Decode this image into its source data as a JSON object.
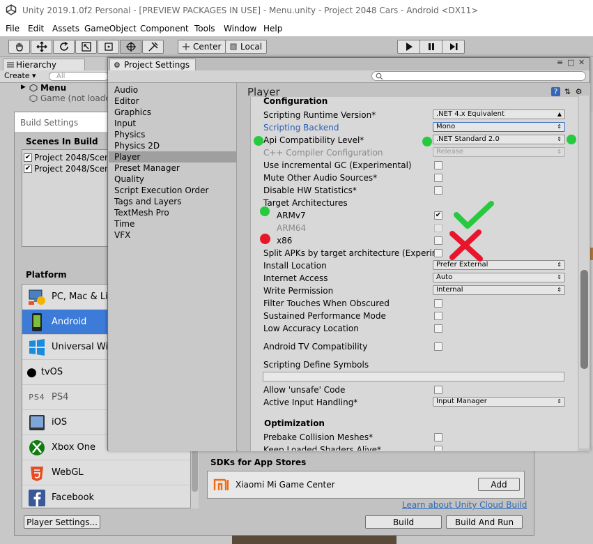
{
  "window": {
    "title": "Unity 2019.1.0f2 Personal - [PREVIEW PACKAGES IN USE] - Menu.unity - Project 2048 Cars - Android <DX11>"
  },
  "menu": [
    "File",
    "Edit",
    "Assets",
    "GameObject",
    "Component",
    "Tools",
    "Window",
    "Help"
  ],
  "toolbar": {
    "center_label": "Center",
    "local_label": "Local"
  },
  "hierarchy": {
    "tab": "Hierarchy",
    "create": "Create",
    "search_placeholder": "All",
    "scene_name": "Menu",
    "item": "Game (not loade"
  },
  "build_settings": {
    "title": "Build Settings",
    "scenes_header": "Scenes In Build",
    "scenes": [
      "Project 2048/Scen",
      "Project 2048/Scen"
    ],
    "platform_header": "Platform",
    "platforms": [
      {
        "name": "PC, Mac & Lin",
        "selected": false
      },
      {
        "name": "Android",
        "selected": true
      },
      {
        "name": "Universal Win",
        "selected": false
      },
      {
        "name": "tvOS",
        "selected": false
      },
      {
        "name": "PS4",
        "selected": false
      },
      {
        "name": "iOS",
        "selected": false
      },
      {
        "name": "Xbox One",
        "selected": false
      },
      {
        "name": "WebGL",
        "selected": false
      },
      {
        "name": "Facebook",
        "selected": false
      }
    ],
    "sdk_header": "SDKs for App Stores",
    "sdk_name": "Xiaomi Mi Game Center",
    "sdk_add": "Add",
    "learn_link": "Learn about Unity Cloud Build",
    "player_settings_btn": "Player Settings...",
    "build_btn": "Build",
    "build_and_run_btn": "Build And Run"
  },
  "project_settings": {
    "tab": "Project Settings",
    "sidebar": [
      "Audio",
      "Editor",
      "Graphics",
      "Input",
      "Physics",
      "Physics 2D",
      "Player",
      "Preset Manager",
      "Quality",
      "Script Execution Order",
      "Tags and Layers",
      "TextMesh Pro",
      "Time",
      "VFX"
    ],
    "selected": "Player",
    "header": "Player",
    "configuration": "Configuration",
    "scripting_runtime_version": {
      "label": "Scripting Runtime Version*",
      "value": ".NET 4.x Equivalent"
    },
    "scripting_backend": {
      "label": "Scripting Backend",
      "value": "Mono"
    },
    "api_compat": {
      "label": "Api Compatibility Level*",
      "value": ".NET Standard 2.0"
    },
    "cpp_compiler": {
      "label": "C++ Compiler Configuration",
      "value": "Release"
    },
    "incremental_gc": "Use incremental GC (Experimental)",
    "mute_audio": "Mute Other Audio Sources*",
    "disable_hw_stats": "Disable HW Statistics*",
    "target_arch": "Target Architectures",
    "armv7": "ARMv7",
    "arm64": "ARM64",
    "x86": "x86",
    "split_apks": "Split APKs by target architecture (Experim",
    "install_location": {
      "label": "Install Location",
      "value": "Prefer External"
    },
    "internet_access": {
      "label": "Internet Access",
      "value": "Auto"
    },
    "write_permission": {
      "label": "Write Permission",
      "value": "Internal"
    },
    "filter_touches": "Filter Touches When Obscured",
    "sustained_perf": "Sustained Performance Mode",
    "low_accuracy": "Low Accuracy Location",
    "android_tv": "Android TV Compatibility",
    "define_symbols": "Scripting Define Symbols",
    "unsafe_code": "Allow 'unsafe' Code",
    "active_input": {
      "label": "Active Input Handling*",
      "value": "Input Manager"
    },
    "optimization": "Optimization",
    "prebake": "Prebake Collision Meshes*",
    "keep_loaded": "Keep Loaded Shaders Alive*"
  },
  "colors": {
    "selection_blue": "#3d7bd9",
    "link_blue": "#2f5fb4",
    "annotation_green": "#27c93f",
    "annotation_red": "#e8152b"
  }
}
